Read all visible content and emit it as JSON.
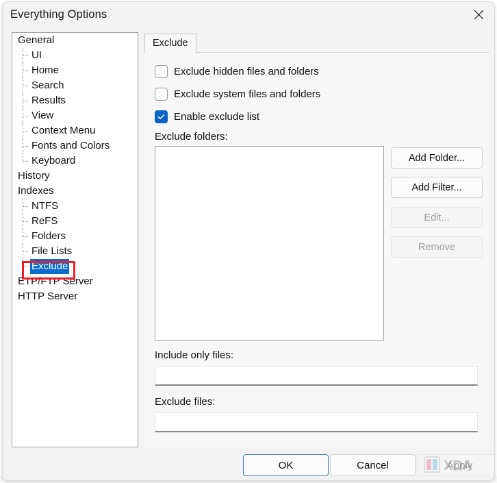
{
  "window": {
    "title": "Everything Options",
    "close_icon": "close-icon"
  },
  "sidebar": {
    "items": [
      {
        "label": "General",
        "level": 0,
        "selected": false,
        "last": false
      },
      {
        "label": "UI",
        "level": 1,
        "selected": false,
        "last": false
      },
      {
        "label": "Home",
        "level": 1,
        "selected": false,
        "last": false
      },
      {
        "label": "Search",
        "level": 1,
        "selected": false,
        "last": false
      },
      {
        "label": "Results",
        "level": 1,
        "selected": false,
        "last": false
      },
      {
        "label": "View",
        "level": 1,
        "selected": false,
        "last": false
      },
      {
        "label": "Context Menu",
        "level": 1,
        "selected": false,
        "last": false
      },
      {
        "label": "Fonts and Colors",
        "level": 1,
        "selected": false,
        "last": false
      },
      {
        "label": "Keyboard",
        "level": 1,
        "selected": false,
        "last": true
      },
      {
        "label": "History",
        "level": 0,
        "selected": false,
        "last": false
      },
      {
        "label": "Indexes",
        "level": 0,
        "selected": false,
        "last": false
      },
      {
        "label": "NTFS",
        "level": 1,
        "selected": false,
        "last": false
      },
      {
        "label": "ReFS",
        "level": 1,
        "selected": false,
        "last": false
      },
      {
        "label": "Folders",
        "level": 1,
        "selected": false,
        "last": false
      },
      {
        "label": "File Lists",
        "level": 1,
        "selected": false,
        "last": false
      },
      {
        "label": "Exclude",
        "level": 1,
        "selected": true,
        "last": true
      },
      {
        "label": "ETP/FTP Server",
        "level": 0,
        "selected": false,
        "last": false
      },
      {
        "label": "HTTP Server",
        "level": 0,
        "selected": false,
        "last": false
      }
    ]
  },
  "tabs": {
    "active": "Exclude",
    "items": [
      {
        "label": "Exclude"
      }
    ]
  },
  "exclude_panel": {
    "checkboxes": [
      {
        "label": "Exclude hidden files and folders",
        "checked": false
      },
      {
        "label": "Exclude system files and folders",
        "checked": false
      },
      {
        "label": "Enable exclude list",
        "checked": true
      }
    ],
    "exclude_folders_label": "Exclude folders:",
    "exclude_folders_items": [],
    "side_buttons": [
      {
        "label": "Add Folder...",
        "enabled": true
      },
      {
        "label": "Add Filter...",
        "enabled": true
      },
      {
        "label": "Edit...",
        "enabled": false
      },
      {
        "label": "Remove",
        "enabled": false
      }
    ],
    "include_only_files_label": "Include only files:",
    "include_only_files_value": "",
    "include_only_files_placeholder": "",
    "exclude_files_label": "Exclude files:",
    "exclude_files_value": "",
    "exclude_files_placeholder": ""
  },
  "dialog_buttons": {
    "ok": "OK",
    "cancel": "Cancel",
    "apply": "Apply"
  },
  "annotation": {
    "color": "#ee1c25",
    "target": "Exclude"
  },
  "watermark": {
    "text": "XDA"
  },
  "colors": {
    "accent": "#0b63c5",
    "selection": "#0a6ccf",
    "annotation": "#ee1c25",
    "window_bg": "#f3f3f3",
    "panel_bg": "#f7f7f7",
    "field_bg": "#ffffff"
  }
}
